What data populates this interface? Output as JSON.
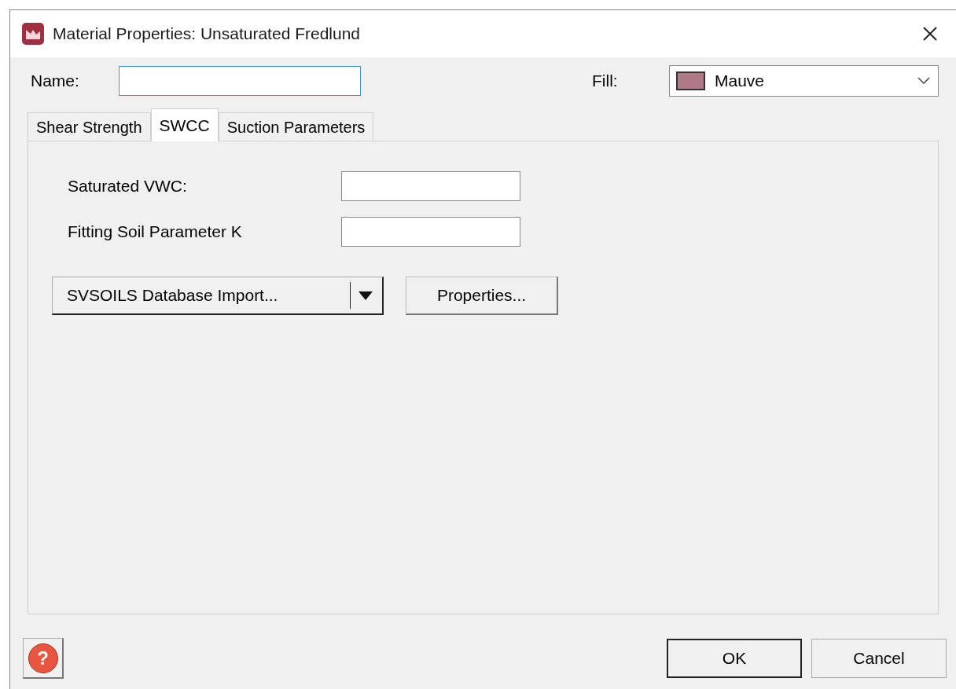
{
  "window": {
    "title": "Material Properties: Unsaturated Fredlund"
  },
  "name_field": {
    "label": "Name:"
  },
  "fill": {
    "label": "Fill:",
    "value": "Mauve",
    "color": "#b07986"
  },
  "tabs": [
    {
      "label": "Shear Strength",
      "selected": false
    },
    {
      "label": "SWCC",
      "selected": true
    },
    {
      "label": "Suction Parameters",
      "selected": false
    }
  ],
  "fields": [
    {
      "label": "Saturated VWC:"
    },
    {
      "label": "Fitting Soil Parameter K"
    }
  ],
  "import_button": {
    "label": "SVSOILS Database Import..."
  },
  "properties_button": {
    "label": "Properties..."
  },
  "help_button": {
    "glyph": "?"
  },
  "buttons": [
    {
      "label": "OK",
      "default": true
    },
    {
      "label": "Cancel",
      "default": false
    }
  ]
}
